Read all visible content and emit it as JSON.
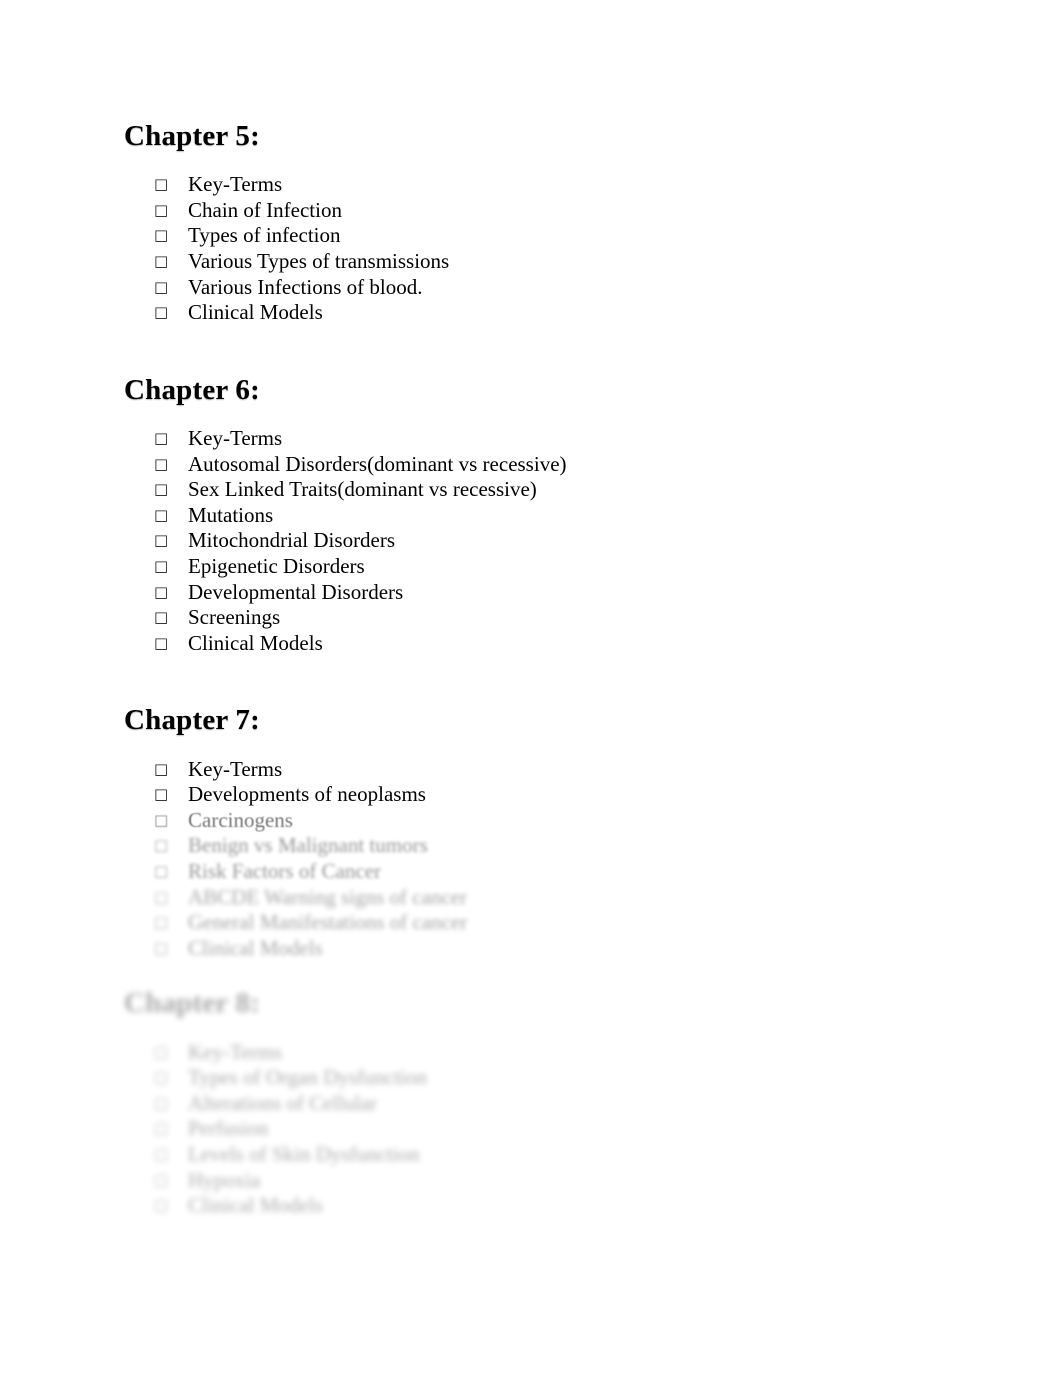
{
  "document": {
    "bullet_glyph": "□",
    "chapters": [
      {
        "title": "Chapter 5:",
        "items": [
          "Key-Terms",
          "Chain of Infection",
          "Types of infection",
          "Various Types of transmissions",
          "Various Infections of blood.",
          "Clinical Models"
        ]
      },
      {
        "title": "Chapter 6:",
        "items": [
          "Key-Terms",
          "Autosomal Disorders(dominant vs recessive)",
          "Sex Linked Traits(dominant vs recessive)",
          "Mutations",
          "Mitochondrial Disorders",
          "Epigenetic Disorders",
          "Developmental Disorders",
          "Screenings",
          "Clinical Models"
        ]
      },
      {
        "title": "Chapter 7:",
        "items": [
          "Key-Terms",
          "Developments of neoplasms",
          "Carcinogens",
          "Benign vs Malignant tumors",
          "Risk Factors of Cancer",
          "ABCDE Warning signs of cancer",
          "General Manifestations of cancer",
          "Clinical Models"
        ]
      },
      {
        "title": "Chapter 8:",
        "items": [
          "Key-Terms",
          "Types of Organ Dysfunction",
          "Alterations of Cellular",
          "Perfusion",
          "Levels of Skin Dysfunction",
          "Hypoxia",
          "Clinical Models"
        ]
      }
    ]
  }
}
